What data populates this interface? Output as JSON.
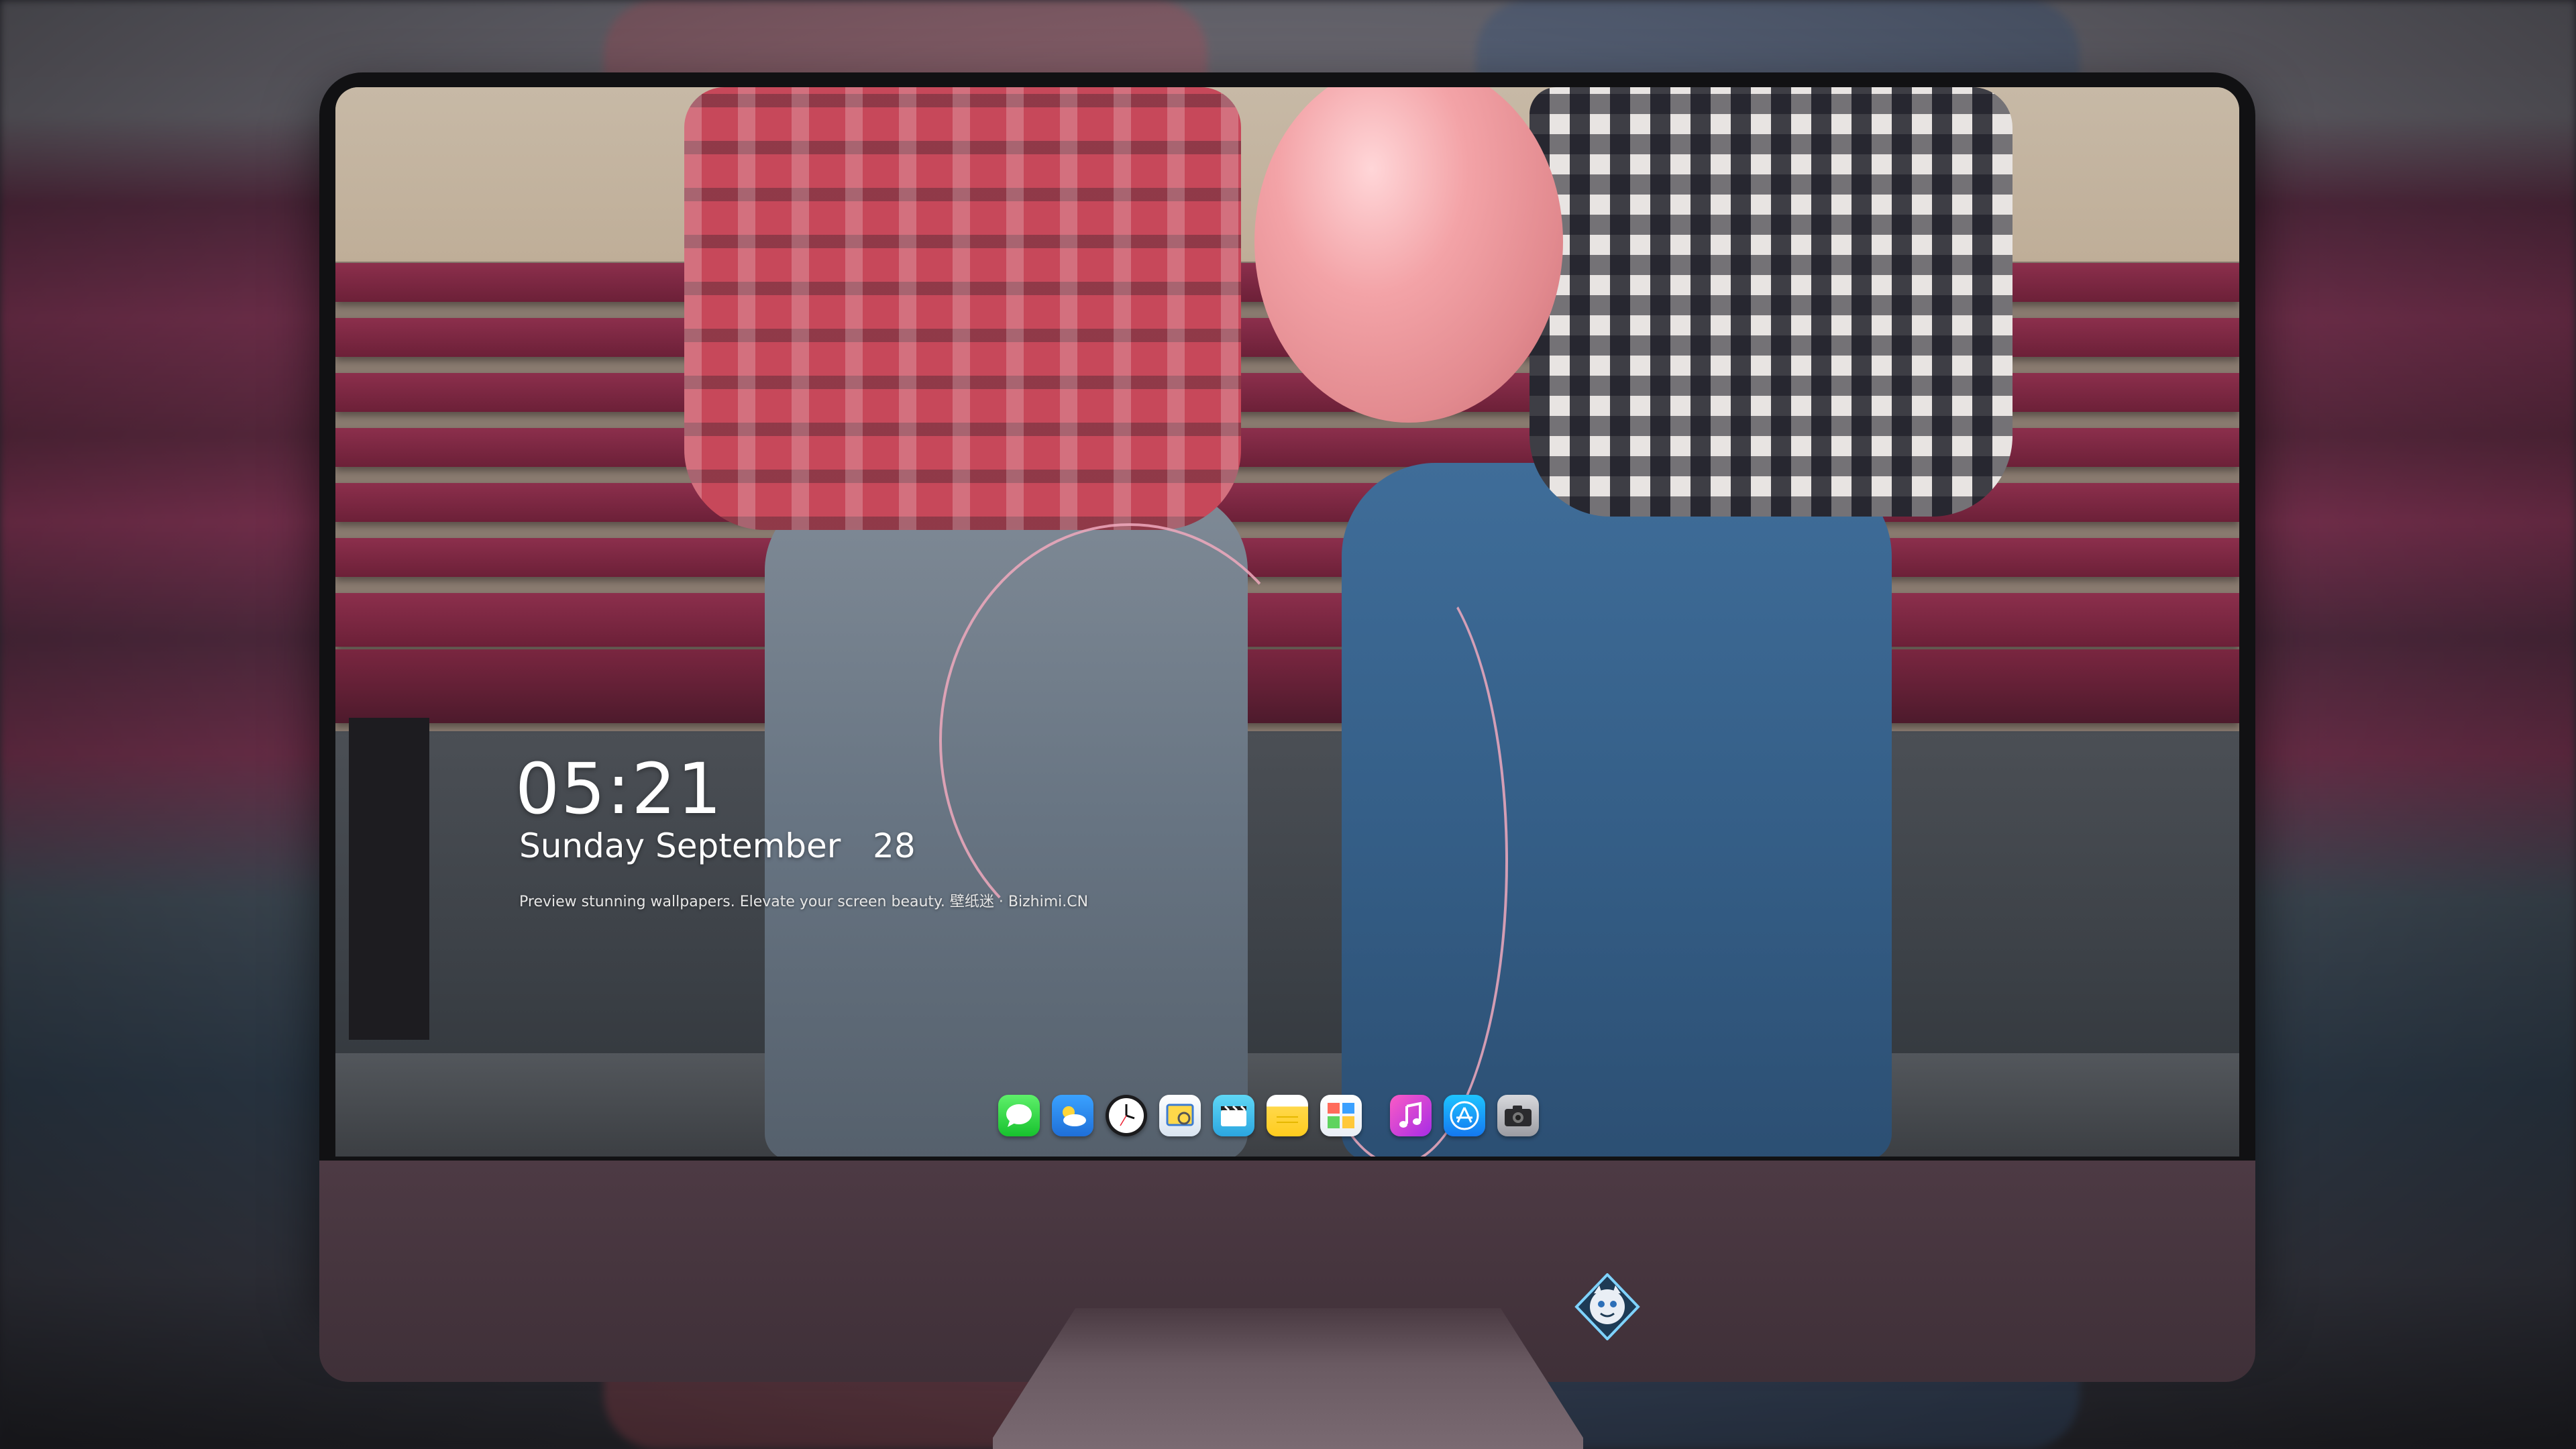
{
  "lockscreen": {
    "time": "05:21",
    "date": "Sunday September   28",
    "tagline": "Preview stunning wallpapers. Elevate your screen beauty. 壁纸迷 · Bizhimi.CN"
  },
  "dock": {
    "apps": [
      {
        "name": "messages-icon"
      },
      {
        "name": "weather-icon"
      },
      {
        "name": "clock-icon"
      },
      {
        "name": "preview-icon"
      },
      {
        "name": "clips-icon"
      },
      {
        "name": "notes-icon"
      },
      {
        "name": "photos-icon"
      },
      {
        "name": "music-icon"
      },
      {
        "name": "app-store-icon"
      },
      {
        "name": "camera-icon"
      }
    ]
  },
  "colors": {
    "bench": "#8c2f4c",
    "monitor_chin": "#4d3a44",
    "balloon": "#f3a3a7"
  }
}
